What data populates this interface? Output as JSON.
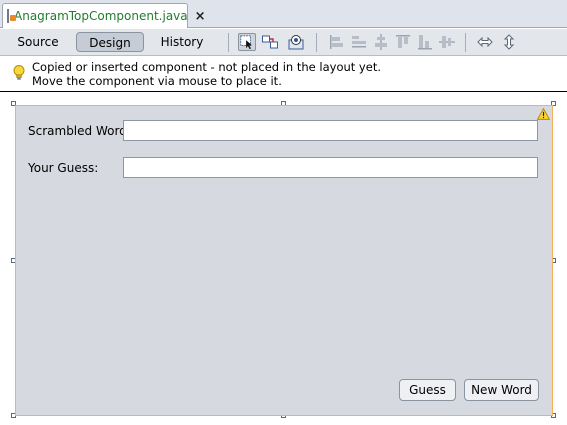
{
  "file_tab": {
    "filename": "AnagramTopComponent.java",
    "close": "×"
  },
  "toolbar": {
    "source_label": "Source",
    "design_label": "Design",
    "history_label": "History",
    "icons": [
      "selection-mode-icon",
      "connection-mode-icon",
      "preview-design-icon",
      "align-left-icon",
      "align-right-icon",
      "center-horizontally-icon",
      "align-top-icon",
      "align-bottom-icon",
      "center-vertically-icon",
      "resize-horizontal-icon",
      "resize-vertical-icon"
    ]
  },
  "notice": {
    "line1": "Copied or inserted component - not placed in the layout yet.",
    "line2": "Move the component via mouse to place it."
  },
  "form": {
    "scrambled_label": "Scrambled Word:",
    "scrambled_value": "",
    "guess_label": "Your Guess:",
    "guess_value": "",
    "guess_button": "Guess",
    "new_word_button": "New Word"
  },
  "colors": {
    "filename": "#1f7e2b",
    "form_background": "#d6d9df",
    "form_border": "#f3b25a",
    "toolbar": "#e3e7ec"
  }
}
